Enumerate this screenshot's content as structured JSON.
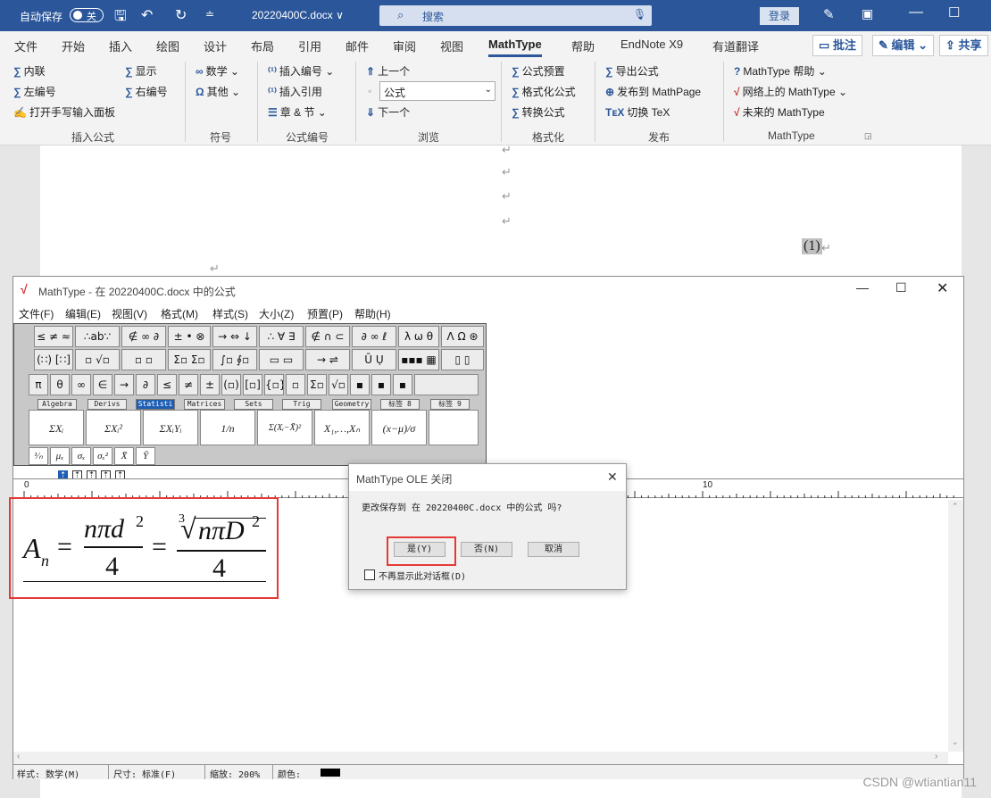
{
  "word": {
    "autosave_label": "自动保存",
    "autosave_state": "关",
    "doc_name": "20220400C.docx ∨",
    "search_placeholder": "搜索",
    "login": "登录",
    "tabs": [
      "文件",
      "开始",
      "插入",
      "绘图",
      "设计",
      "布局",
      "引用",
      "邮件",
      "审阅",
      "视图",
      "MathType",
      "帮助",
      "EndNote X9",
      "有道翻译"
    ],
    "active_tab": "MathType",
    "comment_btn": "批注",
    "edit_btn": "编辑 ⌄",
    "share_btn": "共享"
  },
  "ribbon": {
    "insert_formula": {
      "label": "插入公式",
      "items": [
        "内联",
        "左编号",
        "打开手写输入面板",
        "显示",
        "右编号"
      ]
    },
    "symbols": {
      "label": "符号",
      "items": [
        "数学 ⌄",
        "其他 ⌄"
      ]
    },
    "numbering": {
      "label": "公式编号",
      "items": [
        "插入编号 ⌄",
        "插入引用",
        "章 & 节 ⌄"
      ]
    },
    "browse": {
      "label": "浏览",
      "items": [
        "上一个",
        "公式",
        "下一个"
      ]
    },
    "format": {
      "label": "格式化",
      "items": [
        "公式预置",
        "格式化公式",
        "转换公式"
      ]
    },
    "publish": {
      "label": "发布",
      "items": [
        "导出公式",
        "发布到 MathPage",
        "切换 TeX"
      ]
    },
    "mathtype": {
      "label": "MathType",
      "items": [
        "MathType 帮助 ⌄",
        "网络上的 MathType ⌄",
        "未来的 MathType"
      ]
    }
  },
  "doc": {
    "eq_number": "(1)",
    "para_mark": "↵"
  },
  "mathtype": {
    "title": "MathType - 在 20220400C.docx 中的公式",
    "menu": [
      "文件(F)",
      "编辑(E)",
      "视图(V)",
      "格式(M)",
      "样式(S)",
      "大小(Z)",
      "预置(P)",
      "帮助(H)"
    ],
    "palette_row1": [
      "≤ ≠ ≈",
      "∴ab∵",
      "∉ ∞ ∂",
      "± • ⊗",
      "→ ⇔ ↓",
      "∴ ∀ ∃",
      "∉ ∩ ⊂",
      "∂ ∞ ℓ",
      "λ ω θ",
      "Λ Ω ⊛"
    ],
    "palette_row2": [
      "(∷) [∷]",
      "▫ √▫",
      "▫ ▫",
      "Σ▫ Σ▫",
      "∫▫ ∮▫",
      "▭ ▭",
      "→ ⇌",
      "Ū Ụ",
      "▪▪▪ ▦",
      "▯ ▯"
    ],
    "palette_row3": [
      "π",
      "θ",
      "∞",
      "∈",
      "→",
      "∂",
      "≤",
      "≠",
      "±",
      "(▫)",
      "[▫]",
      "{▫}",
      "▫",
      "Σ▫",
      "√▫",
      "▪",
      "▪",
      "▪"
    ],
    "tabs": [
      "Algebra",
      "Derivs",
      "Statisti",
      "Matrices",
      "Sets",
      "Trig",
      "Geometry",
      "标签 8",
      "标签 9"
    ],
    "active_tab": "Statisti",
    "templates": [
      "ΣXᵢ",
      "ΣXᵢ²",
      "ΣXᵢYᵢ",
      "1/n",
      "Σ(Xᵢ−X̄)²",
      "X₁,…,Xₙ",
      "(x−μ)/σ"
    ],
    "small_templates": [
      "¹⁄ₙ",
      "μₓ",
      "σₓ",
      "σₓ²",
      "X̄",
      "Ȳ"
    ],
    "ruler_left": "0",
    "ruler_right": "10",
    "status": {
      "style": "样式: 数学(M)",
      "size": "尺寸: 标准(F)",
      "zoom": "缩放: 200%",
      "color": "颜色:"
    }
  },
  "formula": {
    "lhs": "A",
    "lhs_sub": "n",
    "eq": "=",
    "num1": "nπd",
    "num1_sup": "2",
    "den1": "4",
    "root_index": "3",
    "num2": "nπD",
    "num2_sup": "2",
    "den2": "4"
  },
  "dialog": {
    "title": "MathType OLE 关闭",
    "message": "更改保存到 在 20220400C.docx 中的公式 吗?",
    "yes": "是(Y)",
    "no": "否(N)",
    "cancel": "取消",
    "checkbox": "不再显示此对话框(D)"
  },
  "watermark": "CSDN @wtiantian11"
}
